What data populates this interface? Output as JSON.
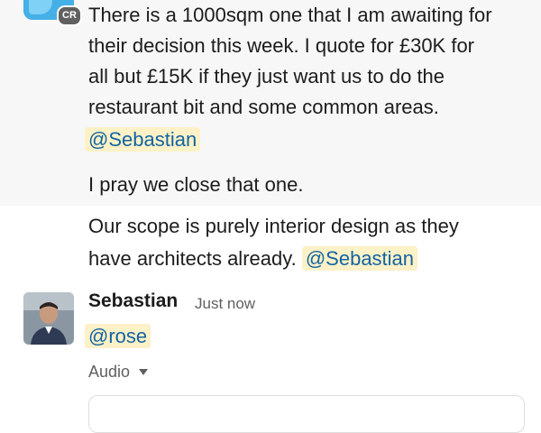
{
  "previous_message": {
    "sender_initials": "CR",
    "lines": [
      "There is a 1000sqm one that I am awaiting for",
      "their decision this week. I quote for £30K for",
      "all but £15K if they just want us to do the",
      "restaurant bit and some common areas."
    ],
    "mention_1": "@Sebastian",
    "line_pray": "I pray we close that one.",
    "scope_line_1": "Our scope is purely interior design as they",
    "scope_line_2": "have architects already.",
    "mention_2": "@Sebastian"
  },
  "reply": {
    "sender": "Sebastian",
    "timestamp": "Just now",
    "mention": "@rose",
    "attachment_label": "Audio"
  },
  "colors": {
    "highlight_bg": "#f7f7f7",
    "mention_bg": "#fdf1c8",
    "mention_text": "#1264a3"
  }
}
